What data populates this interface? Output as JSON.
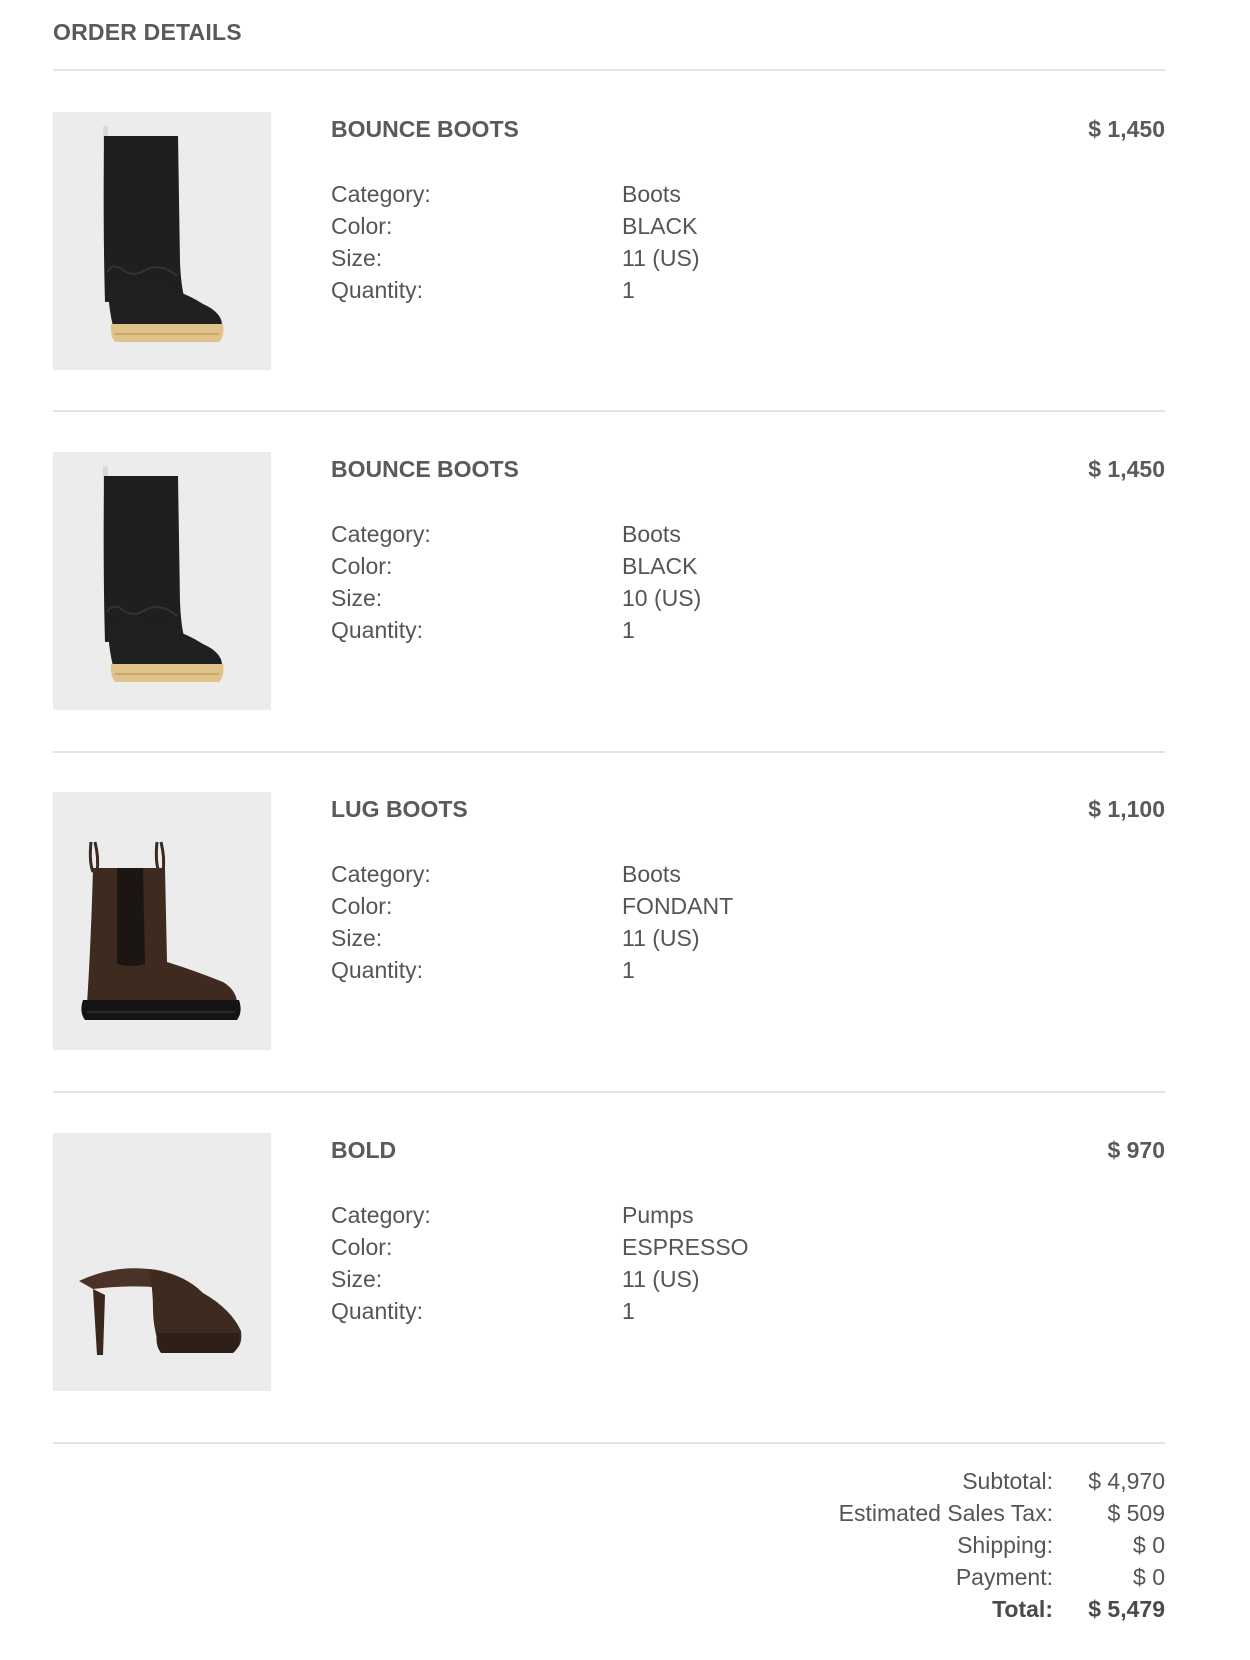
{
  "header": {
    "title": "ORDER DETAILS"
  },
  "items": [
    {
      "name": "BOUNCE BOOTS",
      "price": "$ 1,450",
      "image_icon": "tall-black-boot-icon",
      "attributes": [
        {
          "label": "Category:",
          "value": "Boots"
        },
        {
          "label": "Color:",
          "value": "BLACK"
        },
        {
          "label": "Size:",
          "value": "11 (US)"
        },
        {
          "label": "Quantity:",
          "value": "1"
        }
      ]
    },
    {
      "name": "BOUNCE BOOTS",
      "price": "$ 1,450",
      "image_icon": "tall-black-boot-icon",
      "attributes": [
        {
          "label": "Category:",
          "value": "Boots"
        },
        {
          "label": "Color:",
          "value": "BLACK"
        },
        {
          "label": "Size:",
          "value": "10 (US)"
        },
        {
          "label": "Quantity:",
          "value": "1"
        }
      ]
    },
    {
      "name": "LUG BOOTS",
      "price": "$ 1,100",
      "image_icon": "chelsea-boot-icon",
      "attributes": [
        {
          "label": "Category:",
          "value": "Boots"
        },
        {
          "label": "Color:",
          "value": "FONDANT"
        },
        {
          "label": "Size:",
          "value": "11 (US)"
        },
        {
          "label": "Quantity:",
          "value": "1"
        }
      ]
    },
    {
      "name": "BOLD",
      "price": "$ 970",
      "image_icon": "heeled-mule-icon",
      "attributes": [
        {
          "label": "Category:",
          "value": "Pumps"
        },
        {
          "label": "Color:",
          "value": "ESPRESSO"
        },
        {
          "label": "Size:",
          "value": "11 (US)"
        },
        {
          "label": "Quantity:",
          "value": "1"
        }
      ]
    }
  ],
  "totals": [
    {
      "label": "Subtotal:",
      "value": "$ 4,970"
    },
    {
      "label": "Estimated Sales Tax:",
      "value": "$ 509"
    },
    {
      "label": "Shipping:",
      "value": "$ 0"
    },
    {
      "label": "Payment:",
      "value": "$ 0"
    },
    {
      "label": "Total:",
      "value": "$ 5,479"
    }
  ],
  "colors": {
    "text": "#555555",
    "heading": "#5a5a5a",
    "divider": "#e4e4e4",
    "thumb_bg": "#ececed",
    "boot_black": "#1f1f21",
    "sole_tan": "#e0c38a",
    "brown_leather": "#3e2a1f"
  }
}
